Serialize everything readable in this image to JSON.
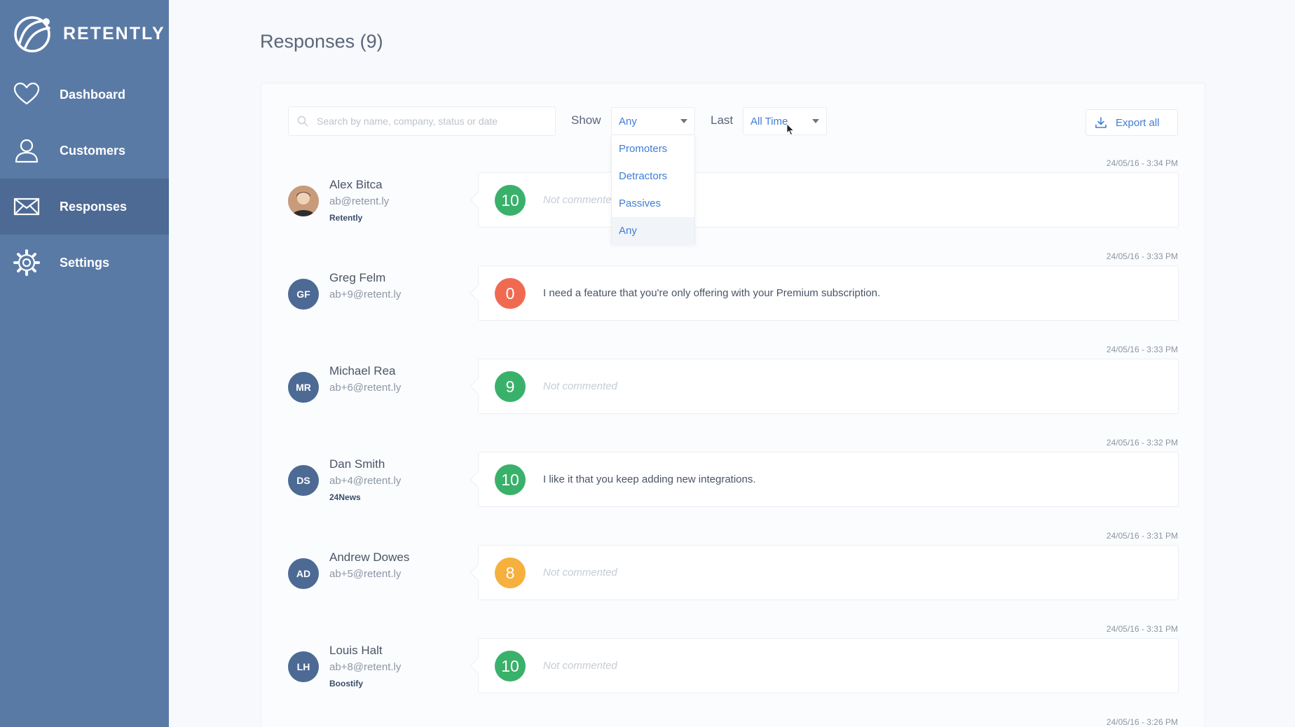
{
  "app": {
    "brand": "RETENTLY"
  },
  "sidebar": {
    "items": [
      {
        "label": "Dashboard",
        "icon": "heart-icon"
      },
      {
        "label": "Customers",
        "icon": "user-icon"
      },
      {
        "label": "Responses",
        "icon": "envelope-icon",
        "active": true
      },
      {
        "label": "Settings",
        "icon": "gear-icon"
      }
    ]
  },
  "main": {
    "title": "Responses (9)",
    "search": {
      "placeholder": "Search by name, company, status or date",
      "value": ""
    },
    "show_filter": {
      "label": "Show",
      "value": "Any",
      "options": [
        "Promoters",
        "Detractors",
        "Passives",
        "Any"
      ]
    },
    "last_filter": {
      "label": "Last",
      "value": "All Time"
    },
    "export": {
      "label": "Export all"
    }
  },
  "responses": [
    {
      "timestamp": "24/05/16 - 3:34 PM",
      "initials": "",
      "name": "Alex Bitca",
      "email": "ab@retent.ly",
      "company": "Retently",
      "score": "10",
      "comment": "Not commented",
      "has_comment": false
    },
    {
      "timestamp": "24/05/16 - 3:33 PM",
      "initials": "GF",
      "name": "Greg Felm",
      "email": "ab+9@retent.ly",
      "company": "",
      "score": "0",
      "comment": "I need a feature that you're only offering with your Premium subscription.",
      "has_comment": true
    },
    {
      "timestamp": "24/05/16 - 3:33 PM",
      "initials": "MR",
      "name": "Michael Rea",
      "email": "ab+6@retent.ly",
      "company": "",
      "score": "9",
      "comment": "Not commented",
      "has_comment": false
    },
    {
      "timestamp": "24/05/16 - 3:32 PM",
      "initials": "DS",
      "name": "Dan Smith",
      "email": "ab+4@retent.ly",
      "company": "24News",
      "score": "10",
      "comment": "I like it that you keep adding new integrations.",
      "has_comment": true
    },
    {
      "timestamp": "24/05/16 - 3:31 PM",
      "initials": "AD",
      "name": "Andrew Dowes",
      "email": "ab+5@retent.ly",
      "company": "",
      "score": "8",
      "comment": "Not commented",
      "has_comment": false
    },
    {
      "timestamp": "24/05/16 - 3:31 PM",
      "initials": "LH",
      "name": "Louis Halt",
      "email": "ab+8@retent.ly",
      "company": "Boostify",
      "score": "10",
      "comment": "Not commented",
      "has_comment": false
    },
    {
      "timestamp": "24/05/16 - 3:26 PM"
    }
  ],
  "colors": {
    "sidebar": "#5a7aa6",
    "sidebar_active": "#4c6a94",
    "promoter": "#39b16a",
    "passive": "#f6b03e",
    "detractor": "#f06a52",
    "link": "#3f7ed6"
  }
}
